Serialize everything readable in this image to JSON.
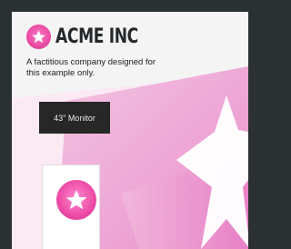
{
  "brand": {
    "name": "ACME INC",
    "tagline": "A factitious company designed for this example only."
  },
  "product": {
    "label": "43\" Monitor"
  },
  "colors": {
    "frame": "#2b3133",
    "card": "#f4f4f5",
    "brand_pink": "#e8489f",
    "monitor_chip": "#262726"
  },
  "icons": {
    "brand_logo": "star-icon",
    "product_logo": "star-icon",
    "background_star": "star-icon"
  }
}
